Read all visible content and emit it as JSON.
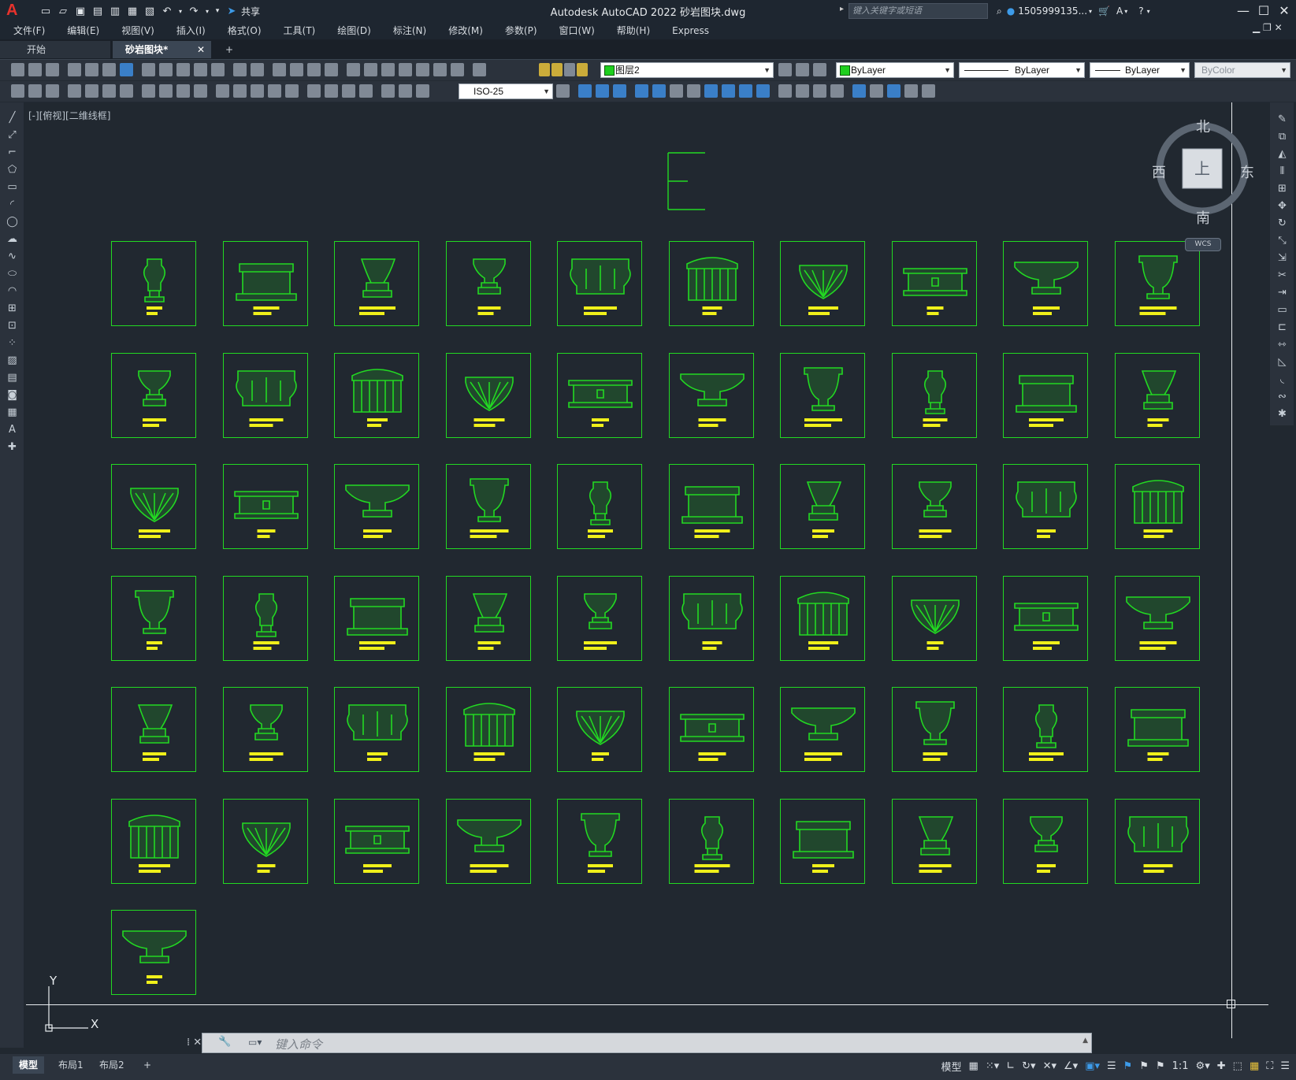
{
  "titlebar": {
    "app_logo": "A",
    "share_label": "共享",
    "title": "Autodesk AutoCAD 2022    砂岩图块.dwg",
    "search_placeholder": "键入关键字或短语",
    "user": "1505999135...",
    "minimize": "—",
    "maximize": "☐",
    "close": "✕"
  },
  "menubar": {
    "items": [
      "文件(F)",
      "编辑(E)",
      "视图(V)",
      "插入(I)",
      "格式(O)",
      "工具(T)",
      "绘图(D)",
      "标注(N)",
      "修改(M)",
      "参数(P)",
      "窗口(W)",
      "帮助(H)",
      "Express"
    ]
  },
  "tabs": {
    "start": "开始",
    "document": "砂岩图块*",
    "close": "✕",
    "add": "+"
  },
  "toolbar": {
    "layer": "图层2",
    "color": "ByLayer",
    "linetype": "ByLayer",
    "lineweight": "ByLayer",
    "plotstyle": "ByColor",
    "dimstyle": "ISO-25",
    "layer_color": "#1fcf1f"
  },
  "viewport": {
    "label": "[-][俯视][二维线框]",
    "compass": {
      "north": "北",
      "south": "南",
      "east": "东",
      "west": "西",
      "top": "上"
    },
    "wcs": "WCS",
    "ucs_x": "X",
    "ucs_y": "Y"
  },
  "drawing": {
    "tile_color": "#22d922",
    "label_color": "#f0f01a",
    "rows": 7,
    "cols": 10,
    "tile_count": 61
  },
  "command": {
    "placeholder": "键入命令"
  },
  "statusbar": {
    "tabs": [
      "模型",
      "布局1",
      "布局2"
    ],
    "add_tab": "+",
    "model_label": "模型",
    "scale": "1:1"
  }
}
